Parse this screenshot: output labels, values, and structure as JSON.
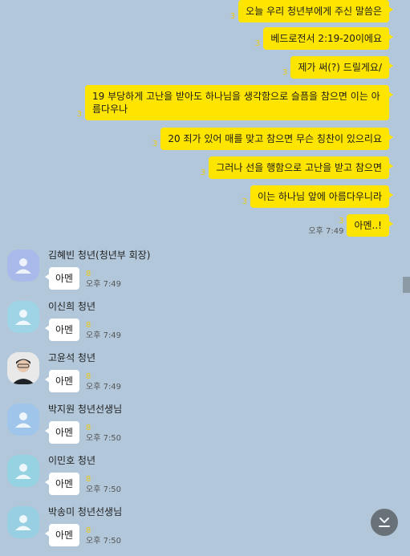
{
  "outgoing": [
    {
      "text": "오늘 우리 청년부에게 주신 말씀은",
      "unread": "3"
    },
    {
      "text": "베드로전서 2:19-20이에요",
      "unread": "3"
    },
    {
      "text": "제가 써(?) 드릴게요/",
      "unread": "3"
    },
    {
      "text": "19 부당하게 고난을 받아도 하나님을 생각함으로 슬픔을 참으면 이는 아름다우나",
      "unread": "3"
    },
    {
      "text": "20 죄가 있어 매를 맞고 참으면 무슨 칭찬이 있으리요",
      "unread": "3"
    },
    {
      "text": "그러나 선을 행함으로 고난을 받고 참으면",
      "unread": "3"
    },
    {
      "text": "이는 하나님 앞에 아름다우니라",
      "unread": "3"
    },
    {
      "text": "아멘..!",
      "unread": "3",
      "time": "오후 7:49"
    }
  ],
  "incoming": [
    {
      "sender": "김혜빈 청년(청년부 회장)",
      "text": "아멘",
      "unread": "8",
      "time": "오후 7:49"
    },
    {
      "sender": "이신희 청년",
      "text": "아멘",
      "unread": "8",
      "time": "오후 7:49"
    },
    {
      "sender": "고윤석 청년",
      "text": "아멘",
      "unread": "8",
      "time": "오후 7:49"
    },
    {
      "sender": "박지원 청년선생님",
      "text": "아멘",
      "unread": "8",
      "time": "오후 7:50"
    },
    {
      "sender": "이민호 청년",
      "text": "아멘",
      "unread": "8",
      "time": "오후 7:50"
    },
    {
      "sender": "박송미 청년선생님",
      "text": "아멘",
      "unread": "8",
      "time": "오후 7:50"
    }
  ],
  "icons": {
    "scroll_down": "chevron-down-icon",
    "avatar_default": "default-profile-icon"
  }
}
